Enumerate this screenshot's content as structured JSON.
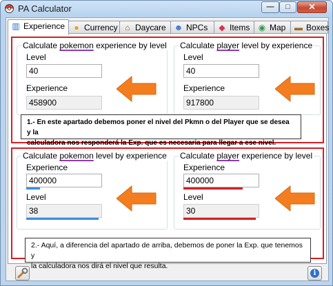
{
  "window": {
    "title": "PA Calculator",
    "app_icon": "pokeball-icon",
    "controls": {
      "minimize_glyph": "—",
      "maximize_glyph": "□",
      "close_glyph": "✕"
    }
  },
  "tabs": [
    {
      "label": "Experience",
      "icon": "bar-chart-icon",
      "glyph": "▥",
      "active": true
    },
    {
      "label": "Currency",
      "icon": "coins-icon",
      "glyph": "●",
      "active": false
    },
    {
      "label": "Daycare",
      "icon": "house-icon",
      "glyph": "⌂",
      "active": false
    },
    {
      "label": "NPCs",
      "icon": "people-icon",
      "glyph": "☻",
      "active": false
    },
    {
      "label": "Items",
      "icon": "gem-icon",
      "glyph": "◆",
      "active": false
    },
    {
      "label": "Map",
      "icon": "globe-icon",
      "glyph": "◉",
      "active": false
    },
    {
      "label": "Boxes",
      "icon": "box-icon",
      "glyph": "▬",
      "active": false
    }
  ],
  "top": {
    "pokemon_exp": {
      "title_pre": "Calculate ",
      "title_word": "pokemon",
      "title_post": " experience by level",
      "input_label": "Level",
      "input_value": "40",
      "output_label": "Experience",
      "output_value": "458900"
    },
    "player_level": {
      "title_pre": "Calculate ",
      "title_word": "player",
      "title_post": " level by experience",
      "input_label": "Level",
      "input_value": "40",
      "output_label": "Experience",
      "output_value": "917800"
    },
    "note_line1": "1.- En este apartado debemos poner el nivel del Pkmn o del Player que se desea y la",
    "note_line2": "calculadora nos responderá la Exp. que es necesaria para llegar a ese nivel."
  },
  "bottom": {
    "pokemon_level": {
      "title_pre": "Calculate ",
      "title_word": "pokemon",
      "title_post": " level by experience",
      "input_label": "Experience",
      "input_value": "400000",
      "output_label": "Level",
      "output_value": "38",
      "input_bar_fill": 0.18,
      "output_bar_fill": 0.95,
      "bar_color": "#3b8ee0"
    },
    "player_exp": {
      "title_pre": "Calculate ",
      "title_word": "player",
      "title_post": " experience by level",
      "input_label": "Experience",
      "input_value": "400000",
      "output_label": "Level",
      "output_value": "30",
      "input_bar_fill": 0.78,
      "output_bar_fill": 0.95,
      "bar_color": "#d51e24"
    },
    "note_line1": "2.- Aquí, a diferencia del apartado de arriba, debemos de poner la Exp. que tenemos y",
    "note_line2": "la calculadora nos dirá el nivel que resulta."
  },
  "footer": {
    "settings_icon": "wrench-icon",
    "settings_glyph": "🔧",
    "info_icon": "info-icon",
    "info_glyph": "i"
  },
  "colors": {
    "annotation_red": "#d51e24",
    "arrow_orange": "#f47d20",
    "underline_purple": "#8f3ab6"
  }
}
